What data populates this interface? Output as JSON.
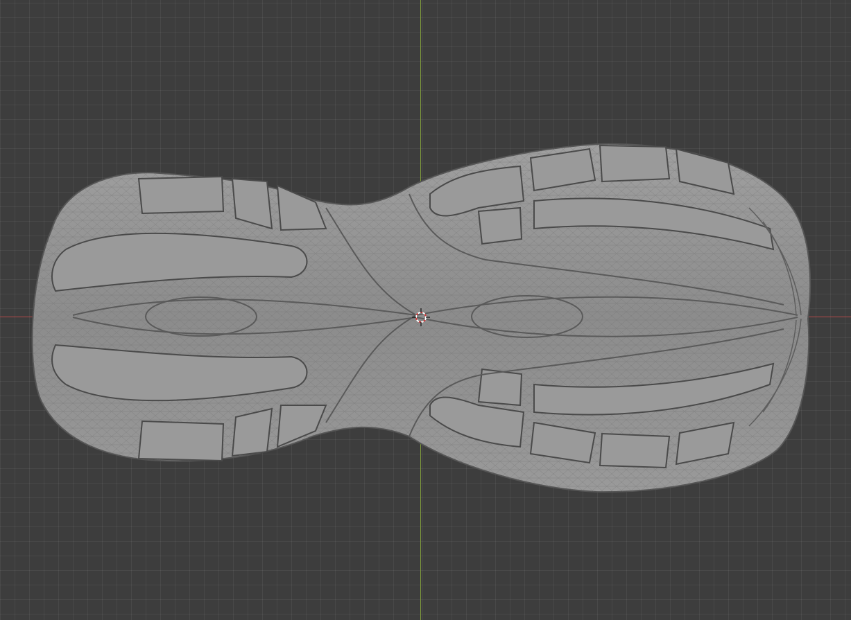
{
  "viewport": {
    "background_color": "#3d3d3d",
    "x_axis_color": "#b84a4a",
    "y_axis_color": "#7f9a3c",
    "mesh_color": "#8c8c8c",
    "cursor_icon": "3d-cursor-icon"
  }
}
